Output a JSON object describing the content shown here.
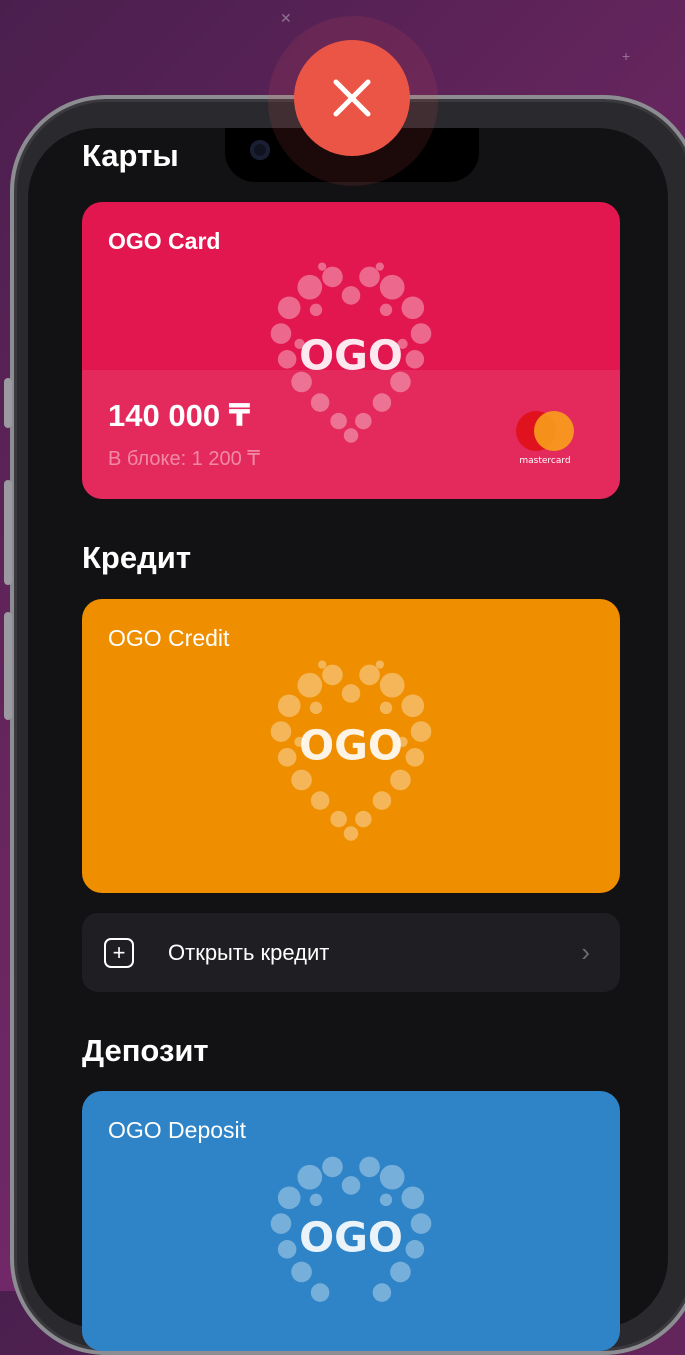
{
  "close": {
    "icon": "close-icon",
    "color": "#ea5545"
  },
  "sections": {
    "cards_title": "Карты",
    "credit_title": "Кредит",
    "deposit_title": "Депозит"
  },
  "cards": {
    "card": {
      "name": "OGO Card",
      "balance": "140 000 ₸",
      "blocked": "В блоке: 1 200 ₸",
      "brand": "mastercard",
      "color": "#e2174f"
    },
    "credit": {
      "name": "OGO Credit",
      "color": "#ef8f00"
    },
    "deposit": {
      "name": "OGO Deposit",
      "color": "#2f84c8"
    },
    "logo_text": "OGO"
  },
  "actions": {
    "open_credit": "Открыть кредит"
  }
}
